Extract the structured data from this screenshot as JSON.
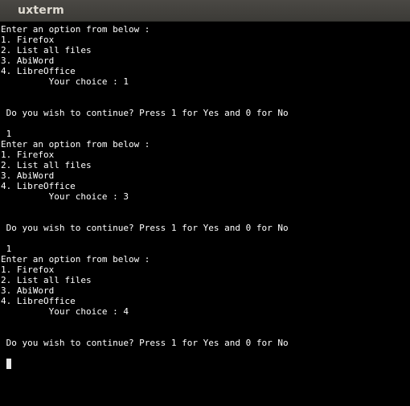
{
  "window": {
    "title": "uxterm"
  },
  "terminal": {
    "lines": [
      "Enter an option from below :",
      "1. Firefox",
      "2. List all files",
      "3. AbiWord",
      "4. LibreOffice",
      "         Your choice : 1",
      " Do you wish to continue? Press 1 for Yes and 0 for No",
      " 1",
      "Enter an option from below :",
      "1. Firefox",
      "2. List all files",
      "3. AbiWord",
      "4. LibreOffice",
      "         Your choice : 3",
      " Do you wish to continue? Press 1 for Yes and 0 for No",
      " 1",
      "Enter an option from below :",
      "1. Firefox",
      "2. List all files",
      "3. AbiWord",
      "4. LibreOffice",
      "         Your choice : 4",
      " Do you wish to continue? Press 1 for Yes and 0 for No"
    ]
  }
}
